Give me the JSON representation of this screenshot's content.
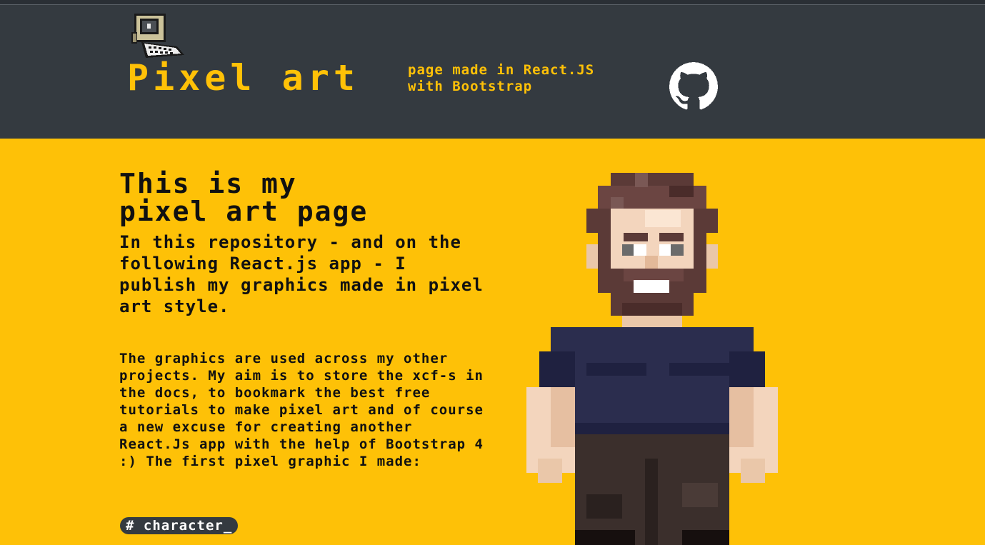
{
  "header": {
    "logo_icon": "retro-computer-icon",
    "title": "Pixel art",
    "subtitle": "page made in React.JS\nwith Bootstrap",
    "github_icon": "github-icon"
  },
  "main": {
    "heading": "This is my\npixel art page",
    "lead": "In this repository - and on the following React.js app - I publish my graphics made in pixel art style.",
    "body": "The graphics are used across my other projects. My aim is to store the xcf-s in the docs, to bookmark the best free tutorials to make pixel art and of course a new excuse for creating another React.Js app with the help of Bootstrap 4 :) The first pixel graphic I made:",
    "tag": "# character_",
    "image_icon": "pixel-character-illustration"
  },
  "colors": {
    "header_bg": "#343a40",
    "accent_yellow": "#ffc107",
    "page_bg": "#fec107",
    "text_dark": "#111111",
    "badge_bg": "#343a40"
  }
}
